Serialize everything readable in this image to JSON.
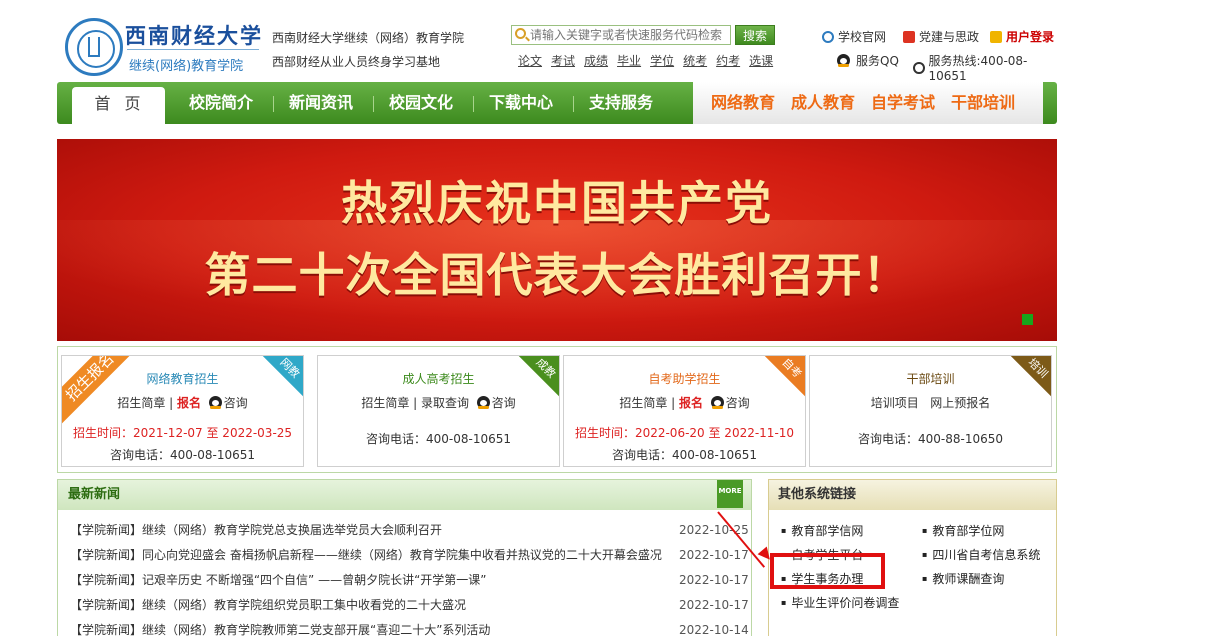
{
  "header": {
    "brand_cn": "西南财经大学",
    "brand_sub": "继续(网络)教育学院",
    "line1": "西南财经大学继续（网络）教育学院",
    "line2": "西部财经从业人员终身学习基地",
    "search_placeholder": "请输入关键字或者快速服务代码检索",
    "search_button": "搜索",
    "quick_links": [
      "论文",
      "考试",
      "成绩",
      "毕业",
      "学位",
      "统考",
      "约考",
      "选课"
    ],
    "top_links": {
      "school": "学校官网",
      "party": "党建与思政",
      "login": "用户登录",
      "qq": "服务QQ",
      "hotline": "服务热线:400-08-10651"
    }
  },
  "nav": {
    "home": "首页",
    "items": [
      "校院简介",
      "新闻资讯",
      "校园文化",
      "下载中心",
      "支持服务"
    ],
    "right_items": [
      "网络教育",
      "成人教育",
      "自学考试",
      "干部培训"
    ]
  },
  "banner": {
    "line1": "热烈庆祝中国共产党",
    "line2": "第二十次全国代表大会胜利召开！"
  },
  "programs": [
    {
      "title": "网络教育招生",
      "title_color": "#2a8ab6",
      "links": [
        "招生简章",
        "报名",
        "咨询"
      ],
      "time_label": "招生时间：2021-12-07 至 2022-03-25",
      "phone": "咨询电话：400-08-10651",
      "tag": "网教",
      "tag_color": "#2fa8c8",
      "badge": "招生报名"
    },
    {
      "title": "成人高考招生",
      "title_color": "#3c8a1c",
      "links": [
        "招生简章",
        "录取查询",
        "咨询"
      ],
      "phone": "咨询电话：400-08-10651",
      "tag": "成教",
      "tag_color": "#4a8f1e"
    },
    {
      "title": "自考助学招生",
      "title_color": "#e2681a",
      "links": [
        "招生简章",
        "报名",
        "咨询"
      ],
      "time_label": "招生时间：2022-06-20 至 2022-11-10",
      "phone": "咨询电话：400-08-10651",
      "tag": "自考",
      "tag_color": "#ea7c22"
    },
    {
      "title": "干部培训",
      "title_color": "#6b4a12",
      "links": [
        "培训项目",
        "网上预报名"
      ],
      "phone": "咨询电话：400-88-10650",
      "tag": "培训",
      "tag_color": "#7d5a18"
    }
  ],
  "news": {
    "title": "最新新闻",
    "more": "MORE",
    "items": [
      {
        "text": "【学院新闻】继续（网络）教育学院党总支换届选举党员大会顺利召开",
        "date": "2022-10-25"
      },
      {
        "text": "【学院新闻】同心向党迎盛会 奋楫扬帆启新程——继续（网络）教育学院集中收看并热议党的二十大开幕会盛况",
        "date": "2022-10-17"
      },
      {
        "text": "【学院新闻】记艰辛历史 不断增强“四个自信” ——曾朝夕院长讲“开学第一课”",
        "date": "2022-10-17"
      },
      {
        "text": "【学院新闻】继续（网络）教育学院组织党员职工集中收看党的二十大盛况",
        "date": "2022-10-17"
      },
      {
        "text": "【学院新闻】继续（网络）教育学院教师第二党支部开展“喜迎二十大”系列活动",
        "date": "2022-10-14"
      }
    ]
  },
  "other": {
    "title": "其他系统链接",
    "left": [
      "教育部学信网",
      "自考学生平台",
      "学生事务办理",
      "毕业生评价问卷调查"
    ],
    "right": [
      "教育部学位网",
      "四川省自考信息系统",
      "教师课酬查询"
    ]
  },
  "colors": {
    "nav_green": "#4f9c2c",
    "accent_orange": "#ee6a14",
    "highlight_red": "#e01010"
  }
}
